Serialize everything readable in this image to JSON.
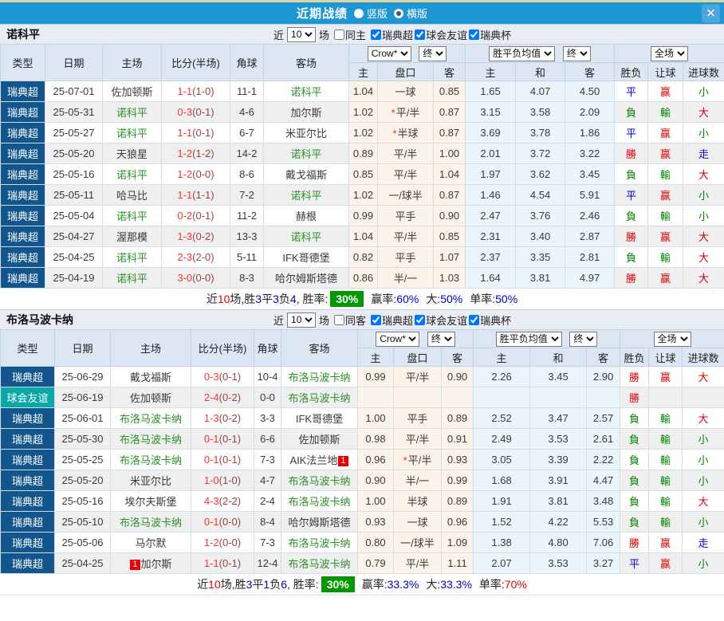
{
  "titlebar": {
    "title": "近期战绩",
    "radio_vertical": "竖版",
    "radio_horizontal": "横版",
    "close_glyph": "✕"
  },
  "controls": {
    "near": "近",
    "count": "10",
    "field": "场",
    "crow": "Crow*",
    "final": "终",
    "avg": "胜平负均值",
    "full": "全场"
  },
  "columns": {
    "main": [
      "类型",
      "日期",
      "主场",
      "比分(半场)",
      "角球",
      "客场"
    ],
    "sub": [
      "主",
      "盘口",
      "客",
      "主",
      "和",
      "客",
      "胜负",
      "让球",
      "进球数"
    ]
  },
  "colors": {
    "titlebar_blue": "#1e96d3",
    "league_blue": "#13568e",
    "league_teal": "#0aa8a8",
    "team_green": "#2a8f2a",
    "win_red": "#e00000",
    "lose_green": "#008800",
    "draw_blue": "#0000dd",
    "summary_green": "#009900"
  },
  "sections": [
    {
      "team": "诺科平",
      "same_label": "同主",
      "same_checked": false,
      "league_filters": [
        {
          "label": "瑞典超",
          "checked": true
        },
        {
          "label": "球会友谊",
          "checked": true
        },
        {
          "label": "瑞典杯",
          "checked": true
        }
      ],
      "rows": [
        {
          "lg": "瑞典超",
          "ls": "blue",
          "dt": "25-07-01",
          "hm": "佐加顿斯",
          "hg": false,
          "hb": "",
          "sc": "1-1",
          "hf": "(1-0)",
          "cn": "11-1",
          "aw": "诺科平",
          "ag": true,
          "ab": "",
          "o1": "1.04",
          "hd": "一球",
          "st": false,
          "o2": "0.85",
          "a1": "1.65",
          "a2": "4.07",
          "a3": "4.50",
          "r1": "平",
          "c1": "blue",
          "r2": "赢",
          "c2": "red",
          "r3": "小",
          "c3": "green"
        },
        {
          "lg": "瑞典超",
          "ls": "blue",
          "dt": "25-05-31",
          "hm": "诺科平",
          "hg": true,
          "hb": "",
          "sc": "0-3",
          "hf": "(0-1)",
          "cn": "4-6",
          "aw": "加尔斯",
          "ag": false,
          "ab": "",
          "o1": "1.02",
          "hd": "平/半",
          "st": true,
          "o2": "0.87",
          "a1": "3.15",
          "a2": "3.58",
          "a3": "2.09",
          "r1": "負",
          "c1": "green",
          "r2": "輸",
          "c2": "green",
          "r3": "大",
          "c3": "red"
        },
        {
          "lg": "瑞典超",
          "ls": "blue",
          "dt": "25-05-27",
          "hm": "诺科平",
          "hg": true,
          "hb": "",
          "sc": "1-1",
          "hf": "(0-1)",
          "cn": "6-7",
          "aw": "米亚尔比",
          "ag": false,
          "ab": "",
          "o1": "1.02",
          "hd": "半球",
          "st": true,
          "o2": "0.87",
          "a1": "3.69",
          "a2": "3.78",
          "a3": "1.86",
          "r1": "平",
          "c1": "blue",
          "r2": "赢",
          "c2": "red",
          "r3": "小",
          "c3": "green"
        },
        {
          "lg": "瑞典超",
          "ls": "blue",
          "dt": "25-05-20",
          "hm": "天狼星",
          "hg": false,
          "hb": "",
          "sc": "1-2",
          "hf": "(1-2)",
          "cn": "14-2",
          "aw": "诺科平",
          "ag": true,
          "ab": "",
          "o1": "0.89",
          "hd": "平/半",
          "st": false,
          "o2": "1.00",
          "a1": "2.01",
          "a2": "3.72",
          "a3": "3.22",
          "r1": "勝",
          "c1": "red",
          "r2": "赢",
          "c2": "red",
          "r3": "走",
          "c3": "blue"
        },
        {
          "lg": "瑞典超",
          "ls": "blue",
          "dt": "25-05-16",
          "hm": "诺科平",
          "hg": true,
          "hb": "",
          "sc": "1-2",
          "hf": "(0-0)",
          "cn": "8-6",
          "aw": "戴戈福斯",
          "ag": false,
          "ab": "",
          "o1": "0.85",
          "hd": "平/半",
          "st": false,
          "o2": "1.04",
          "a1": "1.97",
          "a2": "3.62",
          "a3": "3.45",
          "r1": "負",
          "c1": "green",
          "r2": "輸",
          "c2": "green",
          "r3": "大",
          "c3": "red"
        },
        {
          "lg": "瑞典超",
          "ls": "blue",
          "dt": "25-05-11",
          "hm": "哈马比",
          "hg": false,
          "hb": "",
          "sc": "1-1",
          "hf": "(1-1)",
          "cn": "7-2",
          "aw": "诺科平",
          "ag": true,
          "ab": "",
          "o1": "1.02",
          "hd": "一/球半",
          "st": false,
          "o2": "0.87",
          "a1": "1.46",
          "a2": "4.54",
          "a3": "5.91",
          "r1": "平",
          "c1": "blue",
          "r2": "赢",
          "c2": "red",
          "r3": "小",
          "c3": "green"
        },
        {
          "lg": "瑞典超",
          "ls": "blue",
          "dt": "25-05-04",
          "hm": "诺科平",
          "hg": true,
          "hb": "",
          "sc": "0-2",
          "hf": "(0-1)",
          "cn": "11-2",
          "aw": "赫根",
          "ag": false,
          "ab": "",
          "o1": "0.99",
          "hd": "平手",
          "st": false,
          "o2": "0.90",
          "a1": "2.47",
          "a2": "3.76",
          "a3": "2.46",
          "r1": "負",
          "c1": "green",
          "r2": "輸",
          "c2": "green",
          "r3": "小",
          "c3": "green"
        },
        {
          "lg": "瑞典超",
          "ls": "blue",
          "dt": "25-04-27",
          "hm": "渥那模",
          "hg": false,
          "hb": "",
          "sc": "1-3",
          "hf": "(0-2)",
          "cn": "13-3",
          "aw": "诺科平",
          "ag": true,
          "ab": "",
          "o1": "1.04",
          "hd": "平/半",
          "st": false,
          "o2": "0.85",
          "a1": "2.31",
          "a2": "3.40",
          "a3": "2.87",
          "r1": "勝",
          "c1": "red",
          "r2": "赢",
          "c2": "red",
          "r3": "大",
          "c3": "red"
        },
        {
          "lg": "瑞典超",
          "ls": "blue",
          "dt": "25-04-25",
          "hm": "诺科平",
          "hg": true,
          "hb": "",
          "sc": "2-3",
          "hf": "(2-0)",
          "cn": "5-11",
          "aw": "IFK哥德堡",
          "ag": false,
          "ab": "",
          "o1": "0.82",
          "hd": "平手",
          "st": false,
          "o2": "1.07",
          "a1": "2.37",
          "a2": "3.35",
          "a3": "2.81",
          "r1": "負",
          "c1": "green",
          "r2": "輸",
          "c2": "green",
          "r3": "大",
          "c3": "red"
        },
        {
          "lg": "瑞典超",
          "ls": "blue",
          "dt": "25-04-19",
          "hm": "诺科平",
          "hg": true,
          "hb": "",
          "sc": "3-0",
          "hf": "(0-0)",
          "cn": "8-3",
          "aw": "哈尔姆斯塔德",
          "ag": false,
          "ab": "",
          "o1": "0.86",
          "hd": "半/一",
          "st": false,
          "o2": "1.03",
          "a1": "1.64",
          "a2": "3.81",
          "a3": "4.97",
          "r1": "勝",
          "c1": "red",
          "r2": "赢",
          "c2": "red",
          "r3": "大",
          "c3": "red"
        }
      ],
      "summary": {
        "near": "近",
        "n": "10",
        "t1": "场,胜",
        "w": "3",
        "t2": "平",
        "d": "3",
        "t3": "负",
        "l": "4",
        "t4": ", 胜率:",
        "rate": "30%",
        "t5": "赢率:",
        "winrate": "60%",
        "t6": "大:",
        "big": "50%",
        "t7": "单率:",
        "single": "50%",
        "single_red": false
      }
    },
    {
      "team": "布洛马波卡纳",
      "same_label": "同客",
      "same_checked": false,
      "league_filters": [
        {
          "label": "瑞典超",
          "checked": true
        },
        {
          "label": "球会友谊",
          "checked": true
        },
        {
          "label": "瑞典杯",
          "checked": true
        }
      ],
      "rows": [
        {
          "lg": "瑞典超",
          "ls": "blue",
          "dt": "25-06-29",
          "hm": "戴戈福斯",
          "hg": false,
          "hb": "",
          "sc": "0-3",
          "hf": "(0-1)",
          "cn": "10-4",
          "aw": "布洛马波卡纳",
          "ag": true,
          "ab": "",
          "o1": "0.99",
          "hd": "平/半",
          "st": false,
          "o2": "0.90",
          "a1": "2.26",
          "a2": "3.45",
          "a3": "2.90",
          "r1": "勝",
          "c1": "red",
          "r2": "赢",
          "c2": "red",
          "r3": "大",
          "c3": "red"
        },
        {
          "lg": "球会友谊",
          "ls": "teal",
          "dt": "25-06-19",
          "hm": "佐加顿斯",
          "hg": false,
          "hb": "",
          "sc": "2-4",
          "hf": "(0-2)",
          "cn": "0-0",
          "aw": "布洛马波卡纳",
          "ag": true,
          "ab": "",
          "o1": "",
          "hd": "",
          "st": false,
          "o2": "",
          "a1": "",
          "a2": "",
          "a3": "",
          "r1": "勝",
          "c1": "red",
          "r2": "",
          "c2": "red",
          "r3": "",
          "c3": "red"
        },
        {
          "lg": "瑞典超",
          "ls": "blue",
          "dt": "25-06-01",
          "hm": "布洛马波卡纳",
          "hg": true,
          "hb": "",
          "sc": "1-3",
          "hf": "(0-2)",
          "cn": "3-3",
          "aw": "IFK哥德堡",
          "ag": false,
          "ab": "",
          "o1": "1.00",
          "hd": "平手",
          "st": false,
          "o2": "0.89",
          "a1": "2.52",
          "a2": "3.47",
          "a3": "2.57",
          "r1": "負",
          "c1": "green",
          "r2": "輸",
          "c2": "green",
          "r3": "大",
          "c3": "red"
        },
        {
          "lg": "瑞典超",
          "ls": "blue",
          "dt": "25-05-30",
          "hm": "布洛马波卡纳",
          "hg": true,
          "hb": "",
          "sc": "0-1",
          "hf": "(0-1)",
          "cn": "6-6",
          "aw": "佐加顿斯",
          "ag": false,
          "ab": "",
          "o1": "0.98",
          "hd": "平/半",
          "st": false,
          "o2": "0.91",
          "a1": "2.49",
          "a2": "3.53",
          "a3": "2.61",
          "r1": "負",
          "c1": "green",
          "r2": "輸",
          "c2": "green",
          "r3": "小",
          "c3": "green"
        },
        {
          "lg": "瑞典超",
          "ls": "blue",
          "dt": "25-05-25",
          "hm": "布洛马波卡纳",
          "hg": true,
          "hb": "",
          "sc": "0-1",
          "hf": "(0-1)",
          "cn": "7-3",
          "aw": "AIK法兰地",
          "ag": false,
          "ab": "1",
          "o1": "0.96",
          "hd": "平/半",
          "st": true,
          "o2": "0.93",
          "a1": "3.05",
          "a2": "3.39",
          "a3": "2.22",
          "r1": "負",
          "c1": "green",
          "r2": "輸",
          "c2": "green",
          "r3": "小",
          "c3": "green"
        },
        {
          "lg": "瑞典超",
          "ls": "blue",
          "dt": "25-05-20",
          "hm": "米亚尔比",
          "hg": false,
          "hb": "",
          "sc": "1-0",
          "hf": "(1-0)",
          "cn": "4-7",
          "aw": "布洛马波卡纳",
          "ag": true,
          "ab": "",
          "o1": "0.90",
          "hd": "半/一",
          "st": false,
          "o2": "0.99",
          "a1": "1.68",
          "a2": "3.91",
          "a3": "4.47",
          "r1": "負",
          "c1": "green",
          "r2": "輸",
          "c2": "green",
          "r3": "小",
          "c3": "green"
        },
        {
          "lg": "瑞典超",
          "ls": "blue",
          "dt": "25-05-16",
          "hm": "埃尔夫斯堡",
          "hg": false,
          "hb": "",
          "sc": "4-3",
          "hf": "(2-2)",
          "cn": "2-4",
          "aw": "布洛马波卡纳",
          "ag": true,
          "ab": "",
          "o1": "1.00",
          "hd": "半球",
          "st": false,
          "o2": "0.89",
          "a1": "1.91",
          "a2": "3.81",
          "a3": "3.48",
          "r1": "負",
          "c1": "green",
          "r2": "輸",
          "c2": "green",
          "r3": "大",
          "c3": "red"
        },
        {
          "lg": "瑞典超",
          "ls": "blue",
          "dt": "25-05-10",
          "hm": "布洛马波卡纳",
          "hg": true,
          "hb": "",
          "sc": "0-1",
          "hf": "(0-0)",
          "cn": "8-4",
          "aw": "哈尔姆斯塔德",
          "ag": false,
          "ab": "",
          "o1": "0.93",
          "hd": "一球",
          "st": false,
          "o2": "0.96",
          "a1": "1.52",
          "a2": "4.22",
          "a3": "5.53",
          "r1": "負",
          "c1": "green",
          "r2": "輸",
          "c2": "green",
          "r3": "小",
          "c3": "green"
        },
        {
          "lg": "瑞典超",
          "ls": "blue",
          "dt": "25-05-06",
          "hm": "马尔默",
          "hg": false,
          "hb": "",
          "sc": "1-2",
          "hf": "(0-0)",
          "cn": "7-3",
          "aw": "布洛马波卡纳",
          "ag": true,
          "ab": "",
          "o1": "0.80",
          "hd": "一/球半",
          "st": false,
          "o2": "1.09",
          "a1": "1.38",
          "a2": "4.80",
          "a3": "7.06",
          "r1": "勝",
          "c1": "red",
          "r2": "赢",
          "c2": "red",
          "r3": "走",
          "c3": "blue"
        },
        {
          "lg": "瑞典超",
          "ls": "blue",
          "dt": "25-04-25",
          "hm": "加尔斯",
          "hg": false,
          "hb": "1",
          "sc": "1-1",
          "hf": "(0-1)",
          "cn": "12-4",
          "aw": "布洛马波卡纳",
          "ag": true,
          "ab": "",
          "o1": "0.79",
          "hd": "平/半",
          "st": false,
          "o2": "1.11",
          "a1": "2.07",
          "a2": "3.53",
          "a3": "3.27",
          "r1": "平",
          "c1": "blue",
          "r2": "赢",
          "c2": "red",
          "r3": "小",
          "c3": "green"
        }
      ],
      "summary": {
        "near": "近",
        "n": "10",
        "t1": "场,胜",
        "w": "3",
        "t2": "平",
        "d": "1",
        "t3": "负",
        "l": "6",
        "t4": ", 胜率:",
        "rate": "30%",
        "t5": "赢率:",
        "winrate": "33.3%",
        "t6": "大:",
        "big": "33.3%",
        "t7": "单率:",
        "single": "70%",
        "single_red": true
      }
    }
  ]
}
